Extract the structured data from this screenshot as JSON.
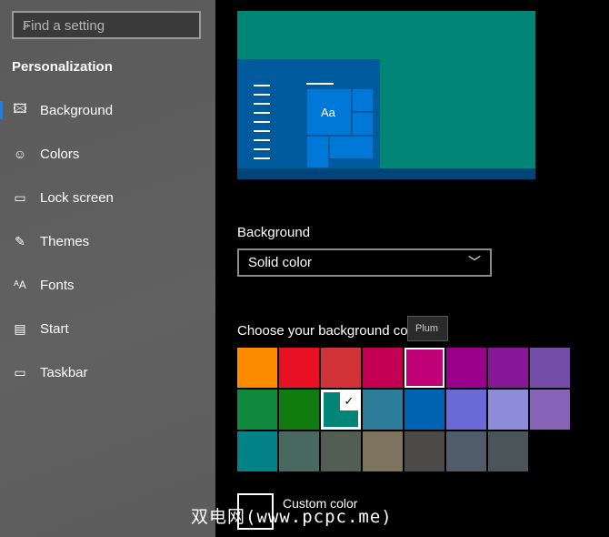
{
  "sidebar": {
    "search_placeholder": "Find a setting",
    "section_title": "Personalization",
    "items": [
      {
        "label": "Background",
        "icon": "image-icon"
      },
      {
        "label": "Colors",
        "icon": "palette-icon"
      },
      {
        "label": "Lock screen",
        "icon": "lock-screen-icon"
      },
      {
        "label": "Themes",
        "icon": "themes-icon"
      },
      {
        "label": "Fonts",
        "icon": "fonts-icon"
      },
      {
        "label": "Start",
        "icon": "start-icon"
      },
      {
        "label": "Taskbar",
        "icon": "taskbar-icon"
      }
    ],
    "selected": "Background"
  },
  "main": {
    "preview_tile_text": "Aa",
    "background_label": "Background",
    "background_value": "Solid color",
    "choose_label": "Choose your background color",
    "tooltip": "Plum",
    "swatches": [
      "#ff8c00",
      "#e81123",
      "#d13438",
      "#c30052",
      "#bf0077",
      "#9a0089",
      "#881798",
      "#744da9",
      "#10893e",
      "#107c10",
      "#018574",
      "#2d7d9a",
      "#0063b1",
      "#6b69d6",
      "#8e8cd8",
      "#8764b8",
      "#038387",
      "#486860",
      "#525e54",
      "#7e735f",
      "#4c4a48",
      "#515c6b",
      "#4a5459"
    ],
    "selected_index": 10,
    "hover_index": 4,
    "custom_color_label": "Custom color"
  },
  "watermark": "双电网(www.pcpc.me)"
}
